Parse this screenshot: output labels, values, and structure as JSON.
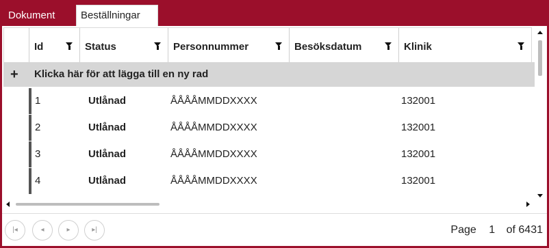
{
  "tabs": [
    {
      "label": "Dokument"
    },
    {
      "label": "Beställningar"
    }
  ],
  "grid": {
    "columns": [
      {
        "label": "Id"
      },
      {
        "label": "Status"
      },
      {
        "label": "Personnummer"
      },
      {
        "label": "Besöksdatum"
      },
      {
        "label": "Klinik"
      }
    ],
    "add_row": {
      "icon": "+",
      "label": "Klicka här för att lägga till en ny rad"
    },
    "rows": [
      {
        "id": "1",
        "status": "Utlånad",
        "personnummer": "ÅÅÅÅMMDDXXXX",
        "besoksdatum": "",
        "klinik": "132001"
      },
      {
        "id": "2",
        "status": "Utlånad",
        "personnummer": "ÅÅÅÅMMDDXXXX",
        "besoksdatum": "",
        "klinik": "132001"
      },
      {
        "id": "3",
        "status": "Utlånad",
        "personnummer": "ÅÅÅÅMMDDXXXX",
        "besoksdatum": "",
        "klinik": "132001"
      },
      {
        "id": "4",
        "status": "Utlånad",
        "personnummer": "ÅÅÅÅMMDDXXXX",
        "besoksdatum": "",
        "klinik": "132001"
      }
    ]
  },
  "pager": {
    "page_label": "Page",
    "current_page": "1",
    "of_label": "of 6431",
    "buttons": {
      "first": "first-page-icon",
      "prev": "prev-page-icon",
      "next": "next-page-icon",
      "last": "last-page-icon"
    }
  },
  "colors": {
    "accent": "#9b0f2b",
    "add_row_bg": "#d6d6d6"
  }
}
